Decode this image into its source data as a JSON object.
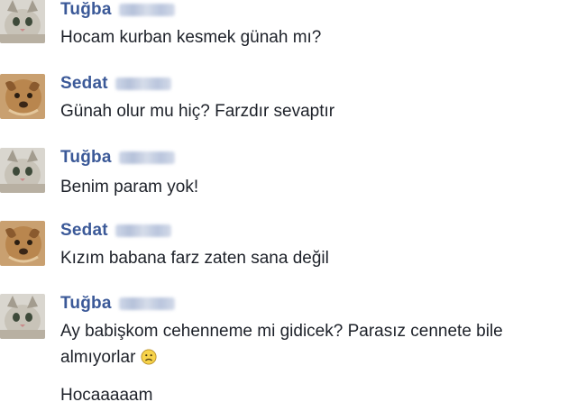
{
  "messages": [
    {
      "sender": "Tuğba",
      "avatar": "cat-avatar",
      "lines": [
        "Hocam kurban kesmek günah mı?"
      ]
    },
    {
      "sender": "Sedat",
      "avatar": "dog-avatar",
      "lines": [
        "Günah olur mu hiç? Farzdır sevaptır"
      ]
    },
    {
      "sender": "Tuğba",
      "avatar": "cat-avatar",
      "lines": [
        "Benim param yok!"
      ]
    },
    {
      "sender": "Sedat",
      "avatar": "dog-avatar",
      "lines": [
        "Kızım babana farz zaten sana değil"
      ]
    },
    {
      "sender": "Tuğba",
      "avatar": "cat-avatar",
      "lines": [
        "Ay babişkom cehenneme mi gidicek? Parasız cennete bile",
        "almıyorlar",
        "Hocaaaaam"
      ],
      "emoji": "frown-emoji-icon"
    }
  ],
  "colors": {
    "name": "#3b5998",
    "text": "#1d2129",
    "background": "#ffffff"
  }
}
